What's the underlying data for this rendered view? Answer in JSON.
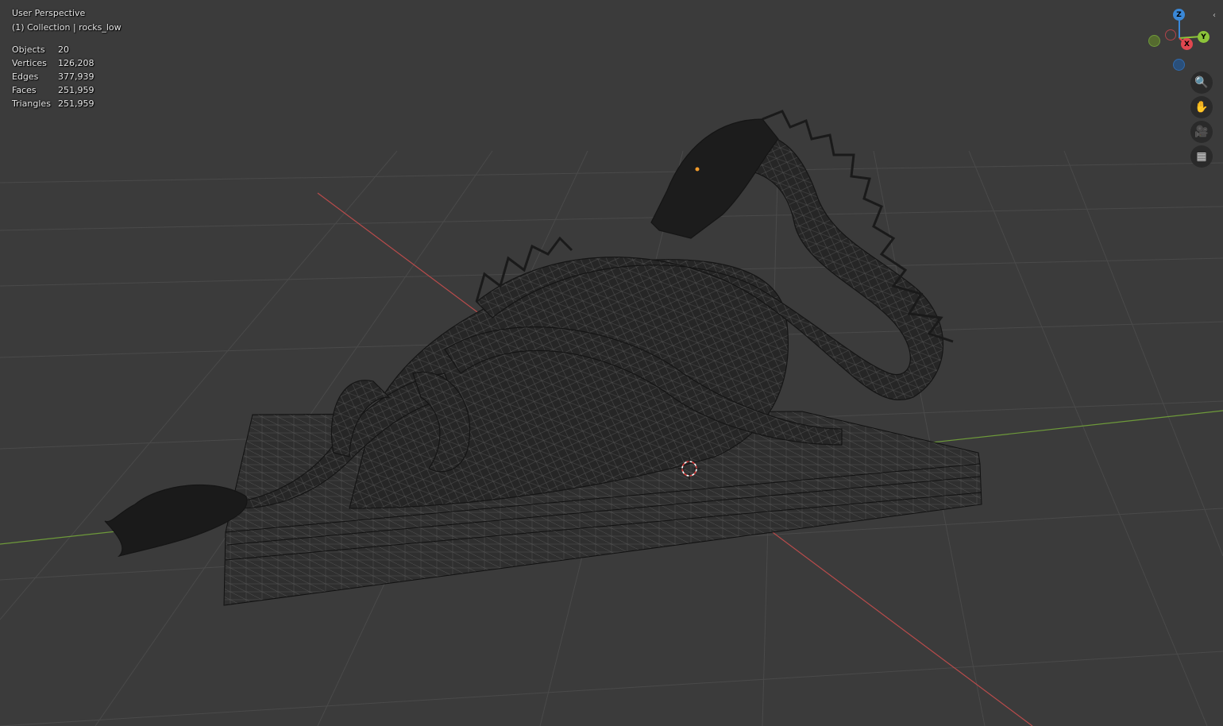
{
  "viewport": {
    "view_name": "User Perspective",
    "collection_line": "(1) Collection | rocks_low",
    "stats": [
      {
        "label": "Objects",
        "value": "20"
      },
      {
        "label": "Vertices",
        "value": "126,208"
      },
      {
        "label": "Edges",
        "value": "377,939"
      },
      {
        "label": "Faces",
        "value": "251,959"
      },
      {
        "label": "Triangles",
        "value": "251,959"
      }
    ]
  },
  "gizmo": {
    "z_label": "Z",
    "y_label": "Y",
    "x_label": "X",
    "colors": {
      "x": "#e0474f",
      "y": "#8cc43a",
      "z": "#3a88d8"
    }
  },
  "nav_buttons": [
    {
      "name": "zoom-icon",
      "glyph": "🔍"
    },
    {
      "name": "pan-hand-icon",
      "glyph": "✋"
    },
    {
      "name": "camera-icon",
      "glyph": "🎥"
    },
    {
      "name": "perspective-grid-icon",
      "glyph": "▦"
    }
  ],
  "collapse_glyph": "‹",
  "colors": {
    "background": "#3b3b3b",
    "grid": "#4a4a4a",
    "x_axis": "#b84b4b",
    "y_axis": "#6e9a3a",
    "mesh": "#1e1e1e",
    "origin_dot": "#f29b2a"
  }
}
